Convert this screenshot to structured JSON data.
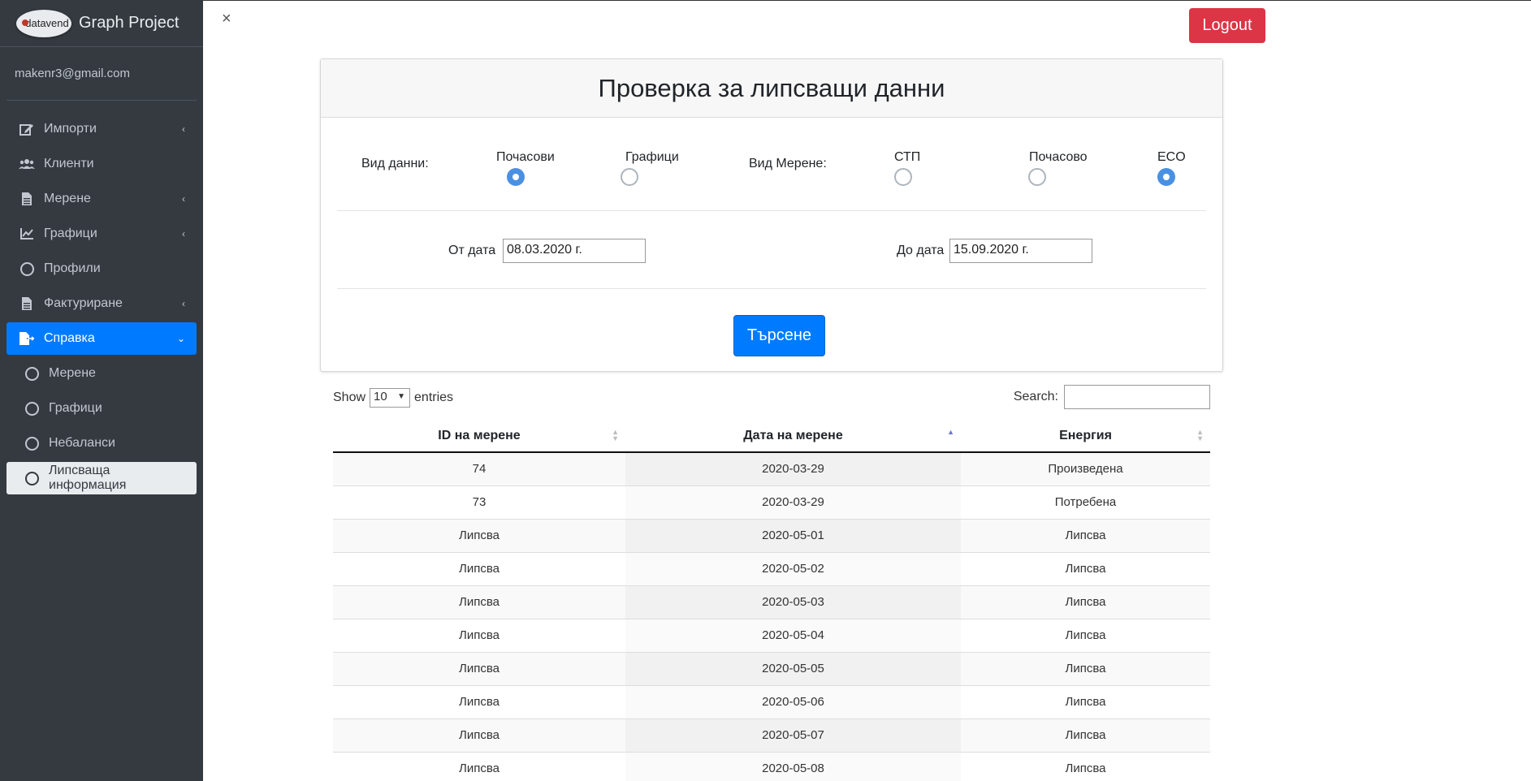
{
  "brand": {
    "logo_text": "datavend",
    "title": "Graph Project"
  },
  "user": {
    "email": "makenr3@gmail.com"
  },
  "sidebar": {
    "items": [
      {
        "label": "Импорти",
        "icon": "edit-icon",
        "chevron": "‹"
      },
      {
        "label": "Клиенти",
        "icon": "users-icon",
        "chevron": ""
      },
      {
        "label": "Мерене",
        "icon": "file-icon",
        "chevron": "‹"
      },
      {
        "label": "Графици",
        "icon": "line-chart-icon",
        "chevron": "‹"
      },
      {
        "label": "Профили",
        "icon": "circle-icon",
        "chevron": ""
      },
      {
        "label": "Фактуриране",
        "icon": "file-icon",
        "chevron": "‹"
      },
      {
        "label": "Справка",
        "icon": "file-export-icon",
        "chevron": "⌄"
      }
    ],
    "subitems": [
      {
        "label": "Мерене"
      },
      {
        "label": "Графици"
      },
      {
        "label": "Небаланси"
      },
      {
        "label": "Липсваща информация"
      }
    ]
  },
  "header": {
    "close": "×",
    "logout_label": "Logout"
  },
  "form": {
    "title": "Проверка за липсващи данни",
    "data_type_label": "Вид данни:",
    "data_type_options": [
      {
        "label": "Почасови",
        "checked": true
      },
      {
        "label": "Графици",
        "checked": false
      }
    ],
    "measure_type_label": "Вид Мерене:",
    "measure_type_options": [
      {
        "label": "СТП",
        "checked": false
      },
      {
        "label": "Почасово",
        "checked": false
      },
      {
        "label": "ECO",
        "checked": true
      }
    ],
    "from_label": "От дата",
    "from_value": "08.03.2020 г.",
    "to_label": "До дата",
    "to_value": "15.09.2020 г.",
    "search_button": "Търсене"
  },
  "datatable": {
    "show_label": "Show",
    "entries_value": "10",
    "entries_label": "entries",
    "search_label": "Search:",
    "columns": [
      "ID на мерене",
      "Дата на мерене",
      "Енергия"
    ],
    "rows": [
      {
        "id": "74",
        "date": "2020-03-29",
        "energy": "Произведена",
        "missing": false
      },
      {
        "id": "73",
        "date": "2020-03-29",
        "energy": "Потребена",
        "missing": false
      },
      {
        "id": "Липсва",
        "date": "2020-05-01",
        "energy": "Липсва",
        "missing": true
      },
      {
        "id": "Липсва",
        "date": "2020-05-02",
        "energy": "Липсва",
        "missing": true
      },
      {
        "id": "Липсва",
        "date": "2020-05-03",
        "energy": "Липсва",
        "missing": true
      },
      {
        "id": "Липсва",
        "date": "2020-05-04",
        "energy": "Липсва",
        "missing": true
      },
      {
        "id": "Липсва",
        "date": "2020-05-05",
        "energy": "Липсва",
        "missing": true
      },
      {
        "id": "Липсва",
        "date": "2020-05-06",
        "energy": "Липсва",
        "missing": true
      },
      {
        "id": "Липсва",
        "date": "2020-05-07",
        "energy": "Липсва",
        "missing": true
      },
      {
        "id": "Липсва",
        "date": "2020-05-08",
        "energy": "Липсва",
        "missing": true
      }
    ]
  },
  "colors": {
    "sidebar_bg": "#343a40",
    "active_nav": "#007bff",
    "logout": "#dc3545",
    "radio_checked": "#4a90e2",
    "missing_text": "#e02020",
    "id_link": "#1f3fd1"
  }
}
